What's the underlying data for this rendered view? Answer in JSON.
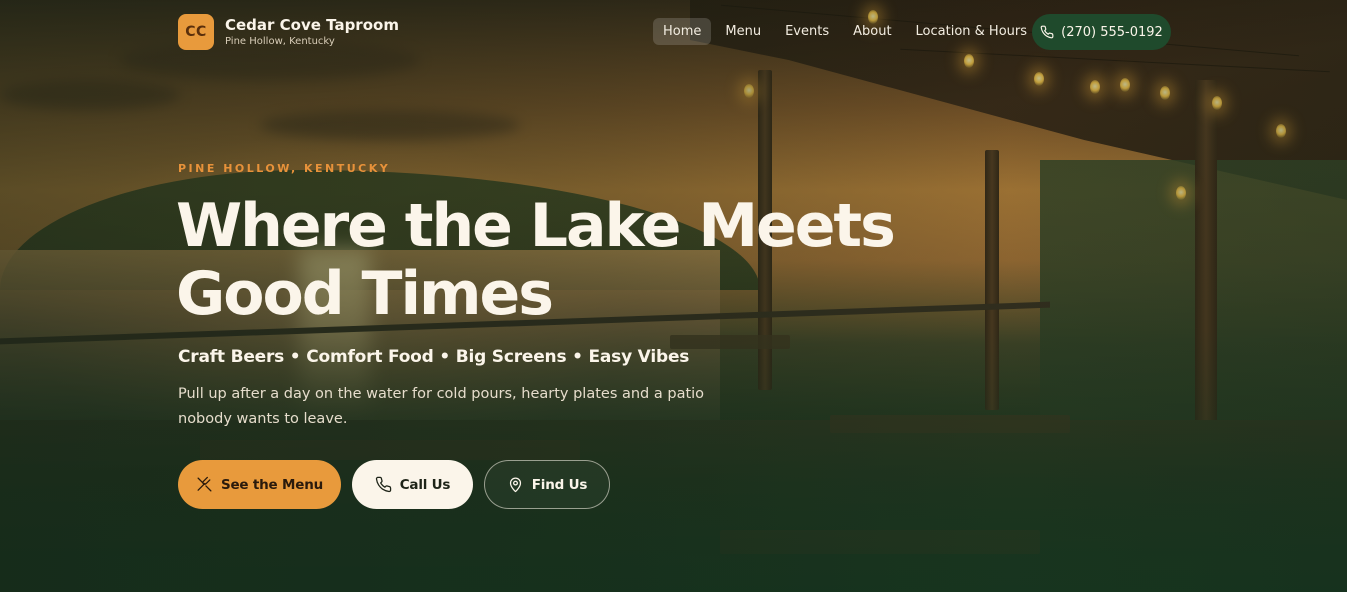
{
  "brand": {
    "logo_initials": "CC",
    "name": "Cedar Cove Taproom",
    "location": "Pine Hollow, Kentucky"
  },
  "nav": {
    "items": [
      {
        "label": "Home",
        "active": true
      },
      {
        "label": "Menu",
        "active": false
      },
      {
        "label": "Events",
        "active": false
      },
      {
        "label": "About",
        "active": false
      },
      {
        "label": "Location & Hours",
        "active": false
      }
    ],
    "phone_label": "(270) 555-0192",
    "phone_icon": "phone-icon"
  },
  "hero": {
    "eyebrow": "PINE HOLLOW, KENTUCKY",
    "headline_line1": "Where the Lake Meets",
    "headline_line2": "Good Times",
    "tagline": "Craft Beers • Comfort Food • Big Screens • Easy Vibes",
    "description": "Pull up after a day on the water for cold pours, hearty plates and a patio nobody wants to leave.",
    "buttons": {
      "menu_label": "See the Menu",
      "menu_icon": "utensils-icon",
      "call_label": "Call Us",
      "call_icon": "phone-icon",
      "find_label": "Find Us",
      "find_icon": "map-pin-icon"
    }
  },
  "colors": {
    "accent": "#e89a3c",
    "dark_green": "#1f4a2c",
    "cream": "#fbf5ea"
  }
}
